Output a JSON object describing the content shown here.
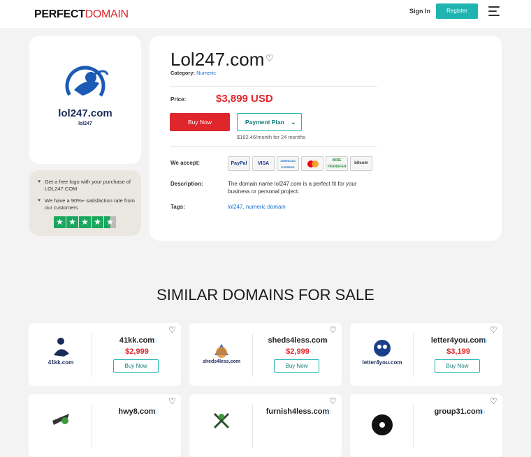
{
  "header": {
    "logo_part1": "PERFECT",
    "logo_part2": "DOMAIN",
    "signin": "Sign In",
    "register": "Register"
  },
  "logo_card": {
    "logo_text": "lol247.com",
    "logo_sub": "lol247"
  },
  "trust": {
    "items": [
      "Get a free logo with your purchase of LOL247.COM",
      "We have a 90%+ satisfaction rate from our customers"
    ],
    "stars": 4.5
  },
  "domain": {
    "title": "Lol247.com",
    "category_label": "Category:",
    "category_value": "Numeric",
    "price_label": "Price:",
    "price": "$3,899 USD",
    "buy_now": "Buy Now",
    "payment_plan": "Payment Plan",
    "monthly": "$162.46/month for 24 months",
    "accept_label": "We accept:",
    "payment_methods": [
      "PayPal",
      "VISA",
      "AMERICAN EXPRESS",
      "mastercard",
      "WIRE TRANSFER",
      "bitcoin"
    ],
    "description_label": "Description:",
    "description": "The domain name lol247.com is a perfect fit for your business or personal project.",
    "tags_label": "Tags:",
    "tags": "lol247, numeric domain"
  },
  "similar": {
    "title": "SIMILAR DOMAINS FOR SALE",
    "cards": [
      {
        "name": "41kk.com",
        "price": "$2,999",
        "buy": "Buy Now",
        "thumb": "41kk.com"
      },
      {
        "name": "sheds4less.com",
        "price": "$2,999",
        "buy": "Buy Now",
        "thumb": "sheds4less.com"
      },
      {
        "name": "letter4you.com",
        "price": "$3,199",
        "buy": "Buy Now",
        "thumb": "letter4you.com"
      },
      {
        "name": "hwy8.com",
        "price": "",
        "buy": "",
        "thumb": ""
      },
      {
        "name": "furnish4less.com",
        "price": "",
        "buy": "",
        "thumb": ""
      },
      {
        "name": "group31.com",
        "price": "",
        "buy": "",
        "thumb": ""
      }
    ]
  },
  "colors": {
    "brand_red": "#e0262d",
    "accent_teal": "#1fb4b0",
    "link_blue": "#1a6fd1",
    "trustpilot_green": "#1aa75d"
  }
}
